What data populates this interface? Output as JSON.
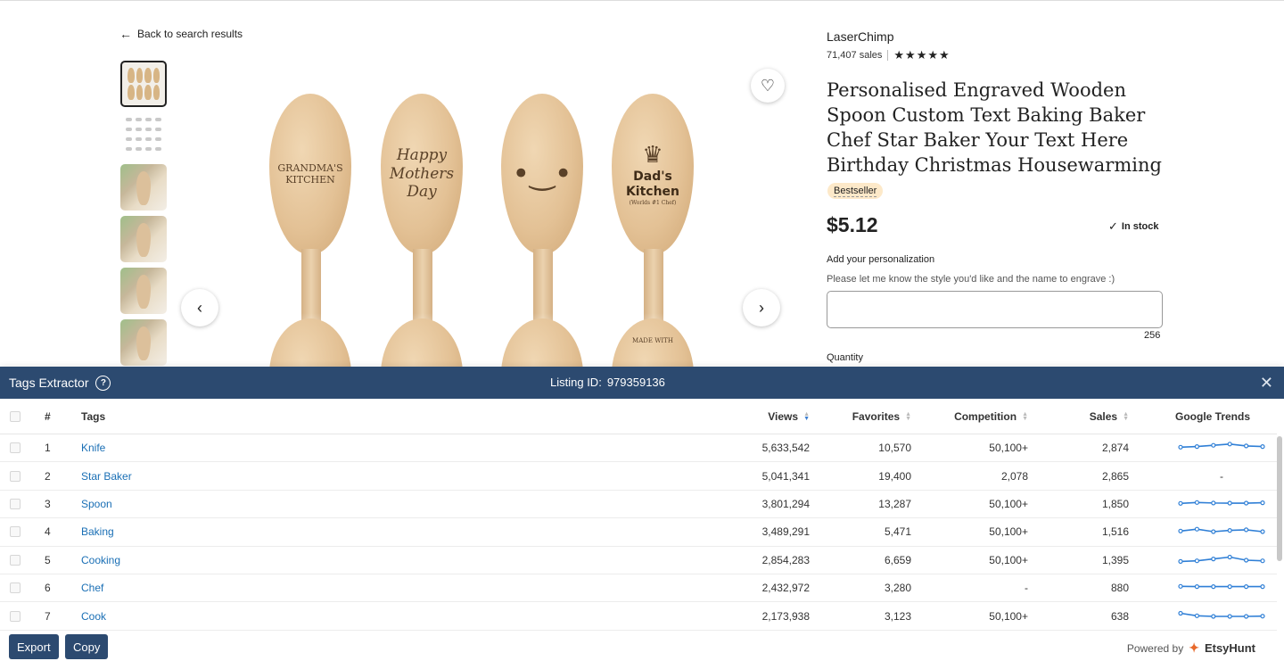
{
  "listing": {
    "back_link": "Back to search results",
    "shop_name": "LaserChimp",
    "sales": "71,407 sales",
    "rating_stars": "★★★★★",
    "title": "Personalised Engraved Wooden Spoon Custom Text Baking Baker Chef Star Baker Your Text Here Birthday Christmas Housewarming",
    "badge": "Bestseller",
    "price": "$5.12",
    "stock": "In stock",
    "personalization_label": "Add your personalization",
    "personalization_hint": "Please let me know the style you'd like and the name to engrave :)",
    "personalization_value": "",
    "char_count": "256",
    "quantity_label": "Quantity",
    "spoon_texts": [
      "GRANDMA'S KITCHEN",
      "Happy Mothers Day",
      "Dad's Kitchen",
      "(Worlds #1 Chef)",
      "MADE WITH"
    ]
  },
  "tags_extractor": {
    "title": "Tags Extractor",
    "listing_id_label": "Listing ID:",
    "listing_id": "979359136",
    "columns": {
      "num": "#",
      "tags": "Tags",
      "views": "Views",
      "favorites": "Favorites",
      "competition": "Competition",
      "sales": "Sales",
      "trends": "Google Trends"
    },
    "rows": [
      {
        "num": "1",
        "tag": "Knife",
        "views": "5,633,542",
        "favorites": "10,570",
        "competition": "50,100+",
        "sales": "2,874",
        "trend": [
          0.55,
          0.6,
          0.7,
          0.8,
          0.65,
          0.6
        ]
      },
      {
        "num": "2",
        "tag": "Star Baker",
        "views": "5,041,341",
        "favorites": "19,400",
        "competition": "2,078",
        "sales": "2,865",
        "trend": null,
        "trend_text": "-"
      },
      {
        "num": "3",
        "tag": "Spoon",
        "views": "3,801,294",
        "favorites": "13,287",
        "competition": "50,100+",
        "sales": "1,850",
        "trend": [
          0.55,
          0.62,
          0.58,
          0.57,
          0.57,
          0.6
        ]
      },
      {
        "num": "4",
        "tag": "Baking",
        "views": "3,489,291",
        "favorites": "5,471",
        "competition": "50,100+",
        "sales": "1,516",
        "trend": [
          0.55,
          0.7,
          0.5,
          0.6,
          0.65,
          0.5
        ]
      },
      {
        "num": "5",
        "tag": "Cooking",
        "views": "2,854,283",
        "favorites": "6,659",
        "competition": "50,100+",
        "sales": "1,395",
        "trend": [
          0.4,
          0.45,
          0.6,
          0.75,
          0.5,
          0.45
        ]
      },
      {
        "num": "6",
        "tag": "Chef",
        "views": "2,432,972",
        "favorites": "3,280",
        "competition": "-",
        "sales": "880",
        "trend": [
          0.62,
          0.6,
          0.6,
          0.6,
          0.6,
          0.6
        ]
      },
      {
        "num": "7",
        "tag": "Cook",
        "views": "2,173,938",
        "favorites": "3,123",
        "competition": "50,100+",
        "sales": "638",
        "trend": [
          0.75,
          0.55,
          0.5,
          0.5,
          0.5,
          0.52
        ]
      }
    ],
    "export_label": "Export",
    "copy_label": "Copy",
    "powered_by": "Powered by",
    "brand": "EtsyHunt"
  },
  "colors": {
    "panel_header": "#2c4a70",
    "tag_link": "#1a6fb5",
    "trend_line": "#2f7fd6",
    "badge_bg": "#fde9c9"
  }
}
